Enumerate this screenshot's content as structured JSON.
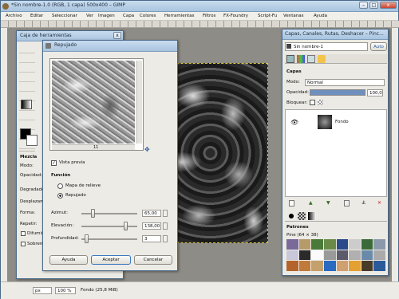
{
  "main": {
    "title": "*Sin nombre-1.0 (RGB, 1 capa) 500x400 – GIMP",
    "menu": [
      "Archivo",
      "Editar",
      "Seleccionar",
      "Ver",
      "Imagen",
      "Capa",
      "Colores",
      "Herramientas",
      "Filtros",
      "FX-Foundry",
      "Script-Fu",
      "Ventanas",
      "Ayuda"
    ],
    "unit": "px",
    "zoom": "100 %",
    "status": "Fondo (25,8 MiB)"
  },
  "toolbox": {
    "title": "Caja de herramientas",
    "options_title": "Mezcla",
    "labels": [
      "Modo:",
      "Opacidad:",
      "Degradado:",
      "Desplazam.:",
      "Forma:",
      "Repetir:",
      "Difumina",
      "Sobremuestreo"
    ]
  },
  "dialog": {
    "title": "Repujado",
    "preview_label": "Vista previa",
    "section": "Función",
    "options": [
      "Mapa de relieve",
      "Repujado"
    ],
    "selected": 1,
    "params": [
      {
        "label": "Azimut:",
        "value": "65,00",
        "level": 0.18
      },
      {
        "label": "Elevación:",
        "value": "138,00",
        "level": 0.77
      },
      {
        "label": "Profundidad:",
        "value": "3",
        "level": 0.04
      }
    ],
    "scroll_value": "11",
    "buttons": [
      "Ayuda",
      "Aceptar",
      "Cancelar"
    ]
  },
  "layers": {
    "title": "Capas, Canales, Rutas, Deshacer – Pinc...",
    "image_select": "Sin nombre-1",
    "auto": "Auto",
    "tab": "Capas",
    "mode_label": "Modo:",
    "mode": "Normal",
    "opacity_label": "Opacidad:",
    "opacity": "100,0",
    "lock_label": "Bloquear:",
    "layer_name": "Fondo",
    "patterns_title": "Patrones",
    "pattern_name": "Pine (64 × 38)"
  }
}
